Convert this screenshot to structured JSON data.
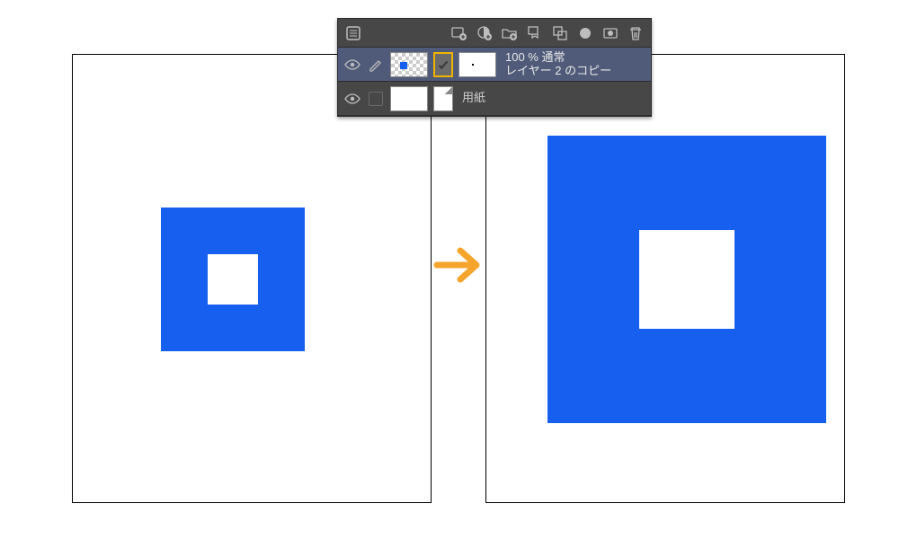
{
  "panel": {
    "toolbar": {
      "icons": [
        "panel-menu-icon",
        "new-layer-icon",
        "new-correction-layer-icon",
        "new-folder-icon",
        "transfer-down-icon",
        "merge-layers-icon",
        "mask-icon",
        "apply-mask-icon",
        "delete-layer-icon"
      ]
    },
    "layers": [
      {
        "id": "layer-copy",
        "opacity_line": "100 % 通常",
        "name": "レイヤー 2 のコピー",
        "selected": true,
        "visible": true,
        "editable": true
      },
      {
        "id": "paper",
        "name": "用紙",
        "selected": false,
        "visible": true,
        "editable": false
      }
    ]
  },
  "arrow_color": "#f6a52c",
  "blue": "#1760ef"
}
